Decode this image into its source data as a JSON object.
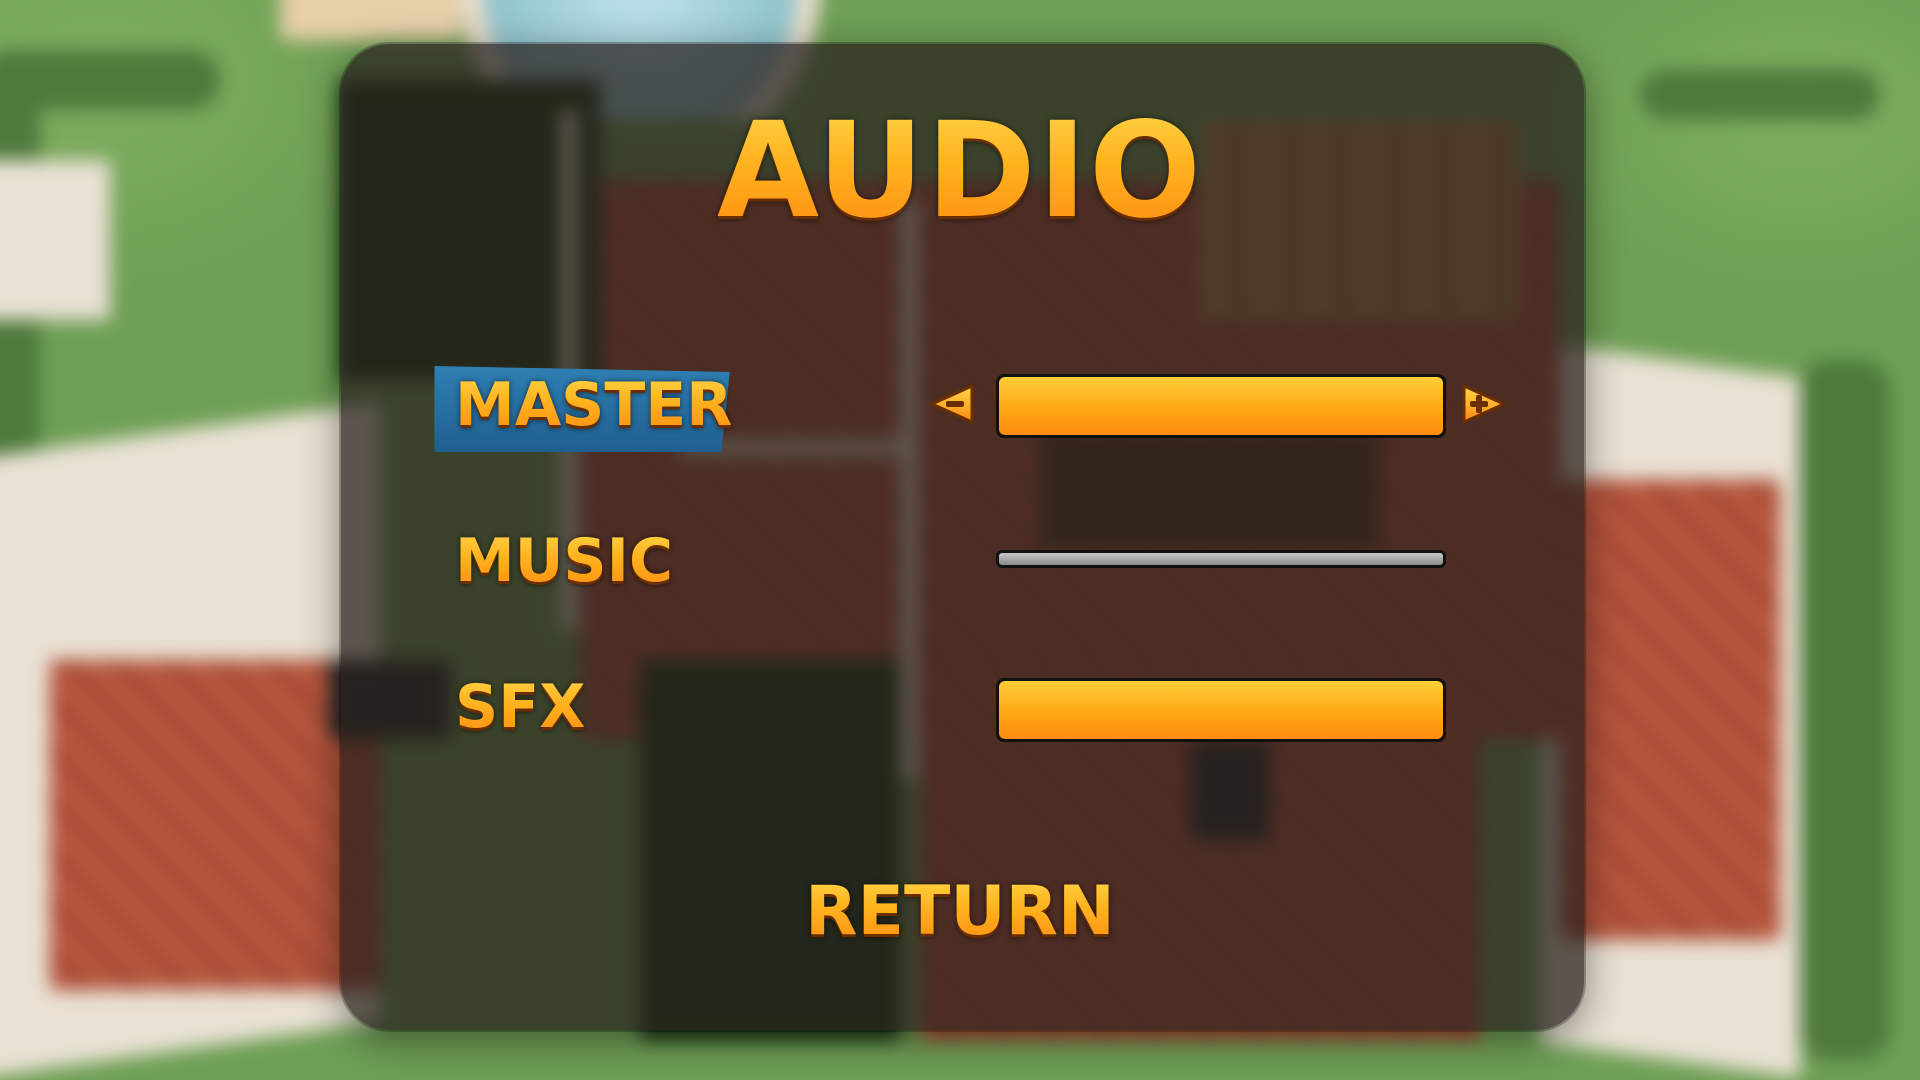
{
  "menu": {
    "title": "AUDIO",
    "selected_row": "MASTER",
    "rows": [
      {
        "label": "MASTER",
        "level": 1.0
      },
      {
        "label": "MUSIC",
        "level": 0.0
      },
      {
        "label": "SFX",
        "level": 1.0
      }
    ],
    "return_label": "RETURN"
  },
  "colors": {
    "accent_orange": "#ffae1a",
    "selector_blue": "#2f7fb3",
    "panel_bg": "#261e1a"
  },
  "icons": {
    "decrease": "left-arrow-minus-icon",
    "increase": "right-arrow-plus-icon"
  }
}
